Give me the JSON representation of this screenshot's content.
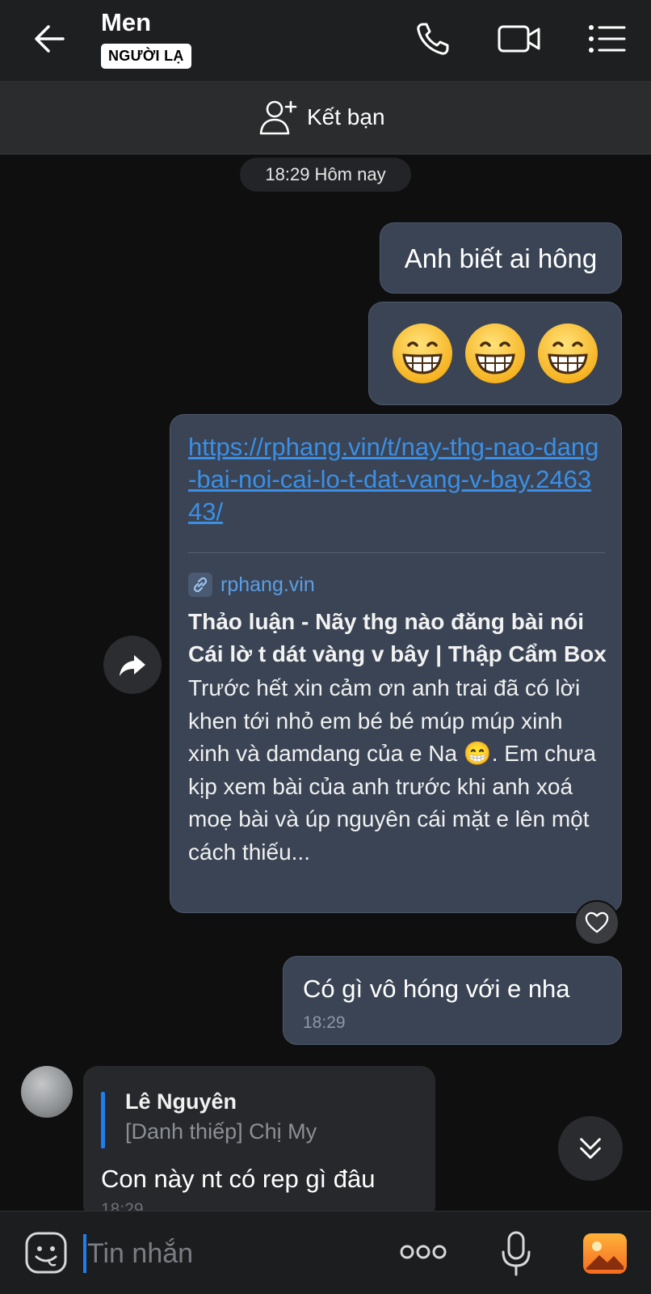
{
  "header": {
    "contact_name": "Men",
    "stranger_badge": "NGƯỜI LẠ",
    "icons": [
      "back-arrow-icon",
      "phone-icon",
      "video-camera-icon",
      "menu-list-icon"
    ]
  },
  "friend_bar": {
    "label": "Kết bạn",
    "icon": "add-friend-icon"
  },
  "divider_time": "18:29 Hôm nay",
  "messages": {
    "m1": {
      "text": "Anh biết ai hông"
    },
    "m2": {
      "emojis": [
        "grinning-face",
        "grinning-face",
        "grinning-face"
      ]
    },
    "m3": {
      "url": "https://rphang.vin/t/nay-thg-nao-dang-bai-noi-cai-lo-t-dat-vang-v-bay.246343/",
      "domain": "rphang.vin",
      "title": "Thảo luận - Nãy thg nào đăng bài nói Cái lờ t dát vàng v bây | Thập Cẩm Box",
      "description": "Trước hết xin cảm ơn anh trai đã có lời khen tới nhỏ em bé bé múp múp xinh xinh và damdang của e Na 😁. Em chưa kịp xem bài của anh trước khi anh xoá moẹ bài và úp nguyên cái mặt e lên một cách thiếu..."
    },
    "m4": {
      "text": "Có gì vô hóng với e nha",
      "time": "18:29"
    },
    "m5": {
      "quote_name": "Lê Nguyên",
      "quote_text": "[Danh thiếp] Chị My",
      "text": "Con này nt có rep gì đâu",
      "time": "18:29"
    }
  },
  "composer": {
    "placeholder": "Tin nhắn"
  },
  "colors": {
    "header_bg": "#1e1f21",
    "bubble_out": "#3a4454",
    "bubble_in": "#27282b",
    "link": "#3b8fe6",
    "accent": "#1f7ef0"
  }
}
